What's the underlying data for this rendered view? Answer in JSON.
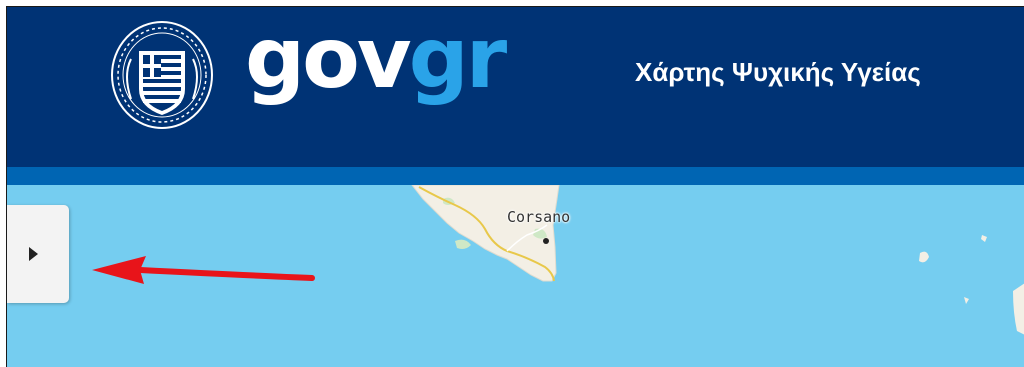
{
  "header": {
    "logo": {
      "part1": "gov",
      "part2": "gr"
    },
    "title": "Χάρτης Ψυχικής Υγείας",
    "colors": {
      "background": "#003375",
      "stripe": "#0065b3",
      "logo_accent": "#2aa3e8"
    }
  },
  "emblem": {
    "icon": "greek-coat-of-arms-icon"
  },
  "map": {
    "place_label": "Corsano",
    "sea_color": "#75cdf0",
    "land_color": "#f3efe5"
  },
  "panel_toggle": {
    "icon": "triangle-right-icon"
  },
  "annotation": {
    "icon": "red-arrow-icon",
    "color": "#e8141a"
  }
}
